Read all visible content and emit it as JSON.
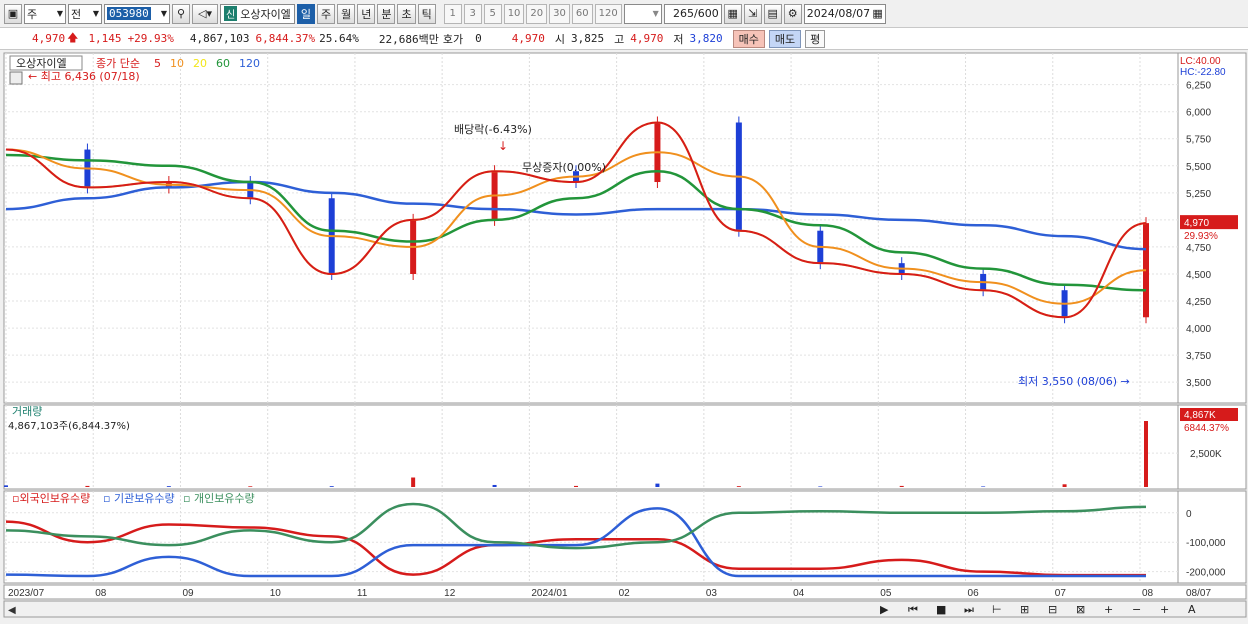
{
  "toolbar": {
    "market": "주",
    "prev": "전",
    "code": "053980",
    "stock_tag": "신",
    "stock_name": "오상자이엘",
    "periods": [
      "일",
      "주",
      "월",
      "년",
      "분",
      "초",
      "틱"
    ],
    "active_period": "일",
    "minute_units": [
      "1",
      "3",
      "5",
      "10",
      "20",
      "30",
      "60",
      "120"
    ],
    "count_value": "265",
    "count_total": "/600",
    "date": "2024/08/07"
  },
  "quote": {
    "price": "4,970",
    "change": "1,145",
    "change_pct": "+29.93%",
    "volume": "4,867,103",
    "volume_pct": "6,844.37%",
    "turnover": "25.64%",
    "amount": "22,686백만",
    "hoga_label": "호가",
    "hoga_value": "0",
    "hoga_price": "4,970",
    "open_label": "시",
    "open": "3,825",
    "high_label": "고",
    "high": "4,970",
    "low_label": "저",
    "low": "3,820",
    "buy_label": "매수",
    "sell_label": "매도",
    "avg_label": "평"
  },
  "chart": {
    "legend_name": "오상자이엘",
    "ma_label": "종가 단순",
    "ma_periods": [
      "5",
      "10",
      "20",
      "60",
      "120"
    ],
    "max_label": "최고 6,436 (07/18)",
    "min_label": "최저 3,550 (08/06)",
    "lc_label": "LC:40.00",
    "hc_label": "HC:-22.80",
    "dividend_label": "배당락(-6.43%)",
    "bonus_label": "무상증자(0.00%)",
    "last_price_label": "4,970",
    "last_pct_label": "29.93%",
    "volume_title": "거래량",
    "volume_value_label": "4,867,103주(6,844.37%)",
    "volume_last_label": "4,867K",
    "volume_last_pct": "6844.37%",
    "holdings_legend": [
      "외국인보유수량",
      "기관보유수량",
      "개인보유수량"
    ],
    "price_ticks": [
      "6,250",
      "6,000",
      "5,750",
      "5,500",
      "5,250",
      "5,000",
      "4,750",
      "4,500",
      "4,250",
      "4,000",
      "3,750",
      "3,500"
    ],
    "volume_tick": "2,500K",
    "holdings_ticks": [
      "0",
      "-100,000",
      "-200,000"
    ],
    "x_ticks": [
      "2023/07",
      "08",
      "09",
      "10",
      "11",
      "12",
      "2024/01",
      "02",
      "03",
      "04",
      "05",
      "06",
      "07",
      "08"
    ],
    "x_right_label": "08/07"
  },
  "colors": {
    "ma5": "#d61b1b",
    "ma10": "#f0901e",
    "ma20": "#f2e61a",
    "ma60": "#22953a",
    "ma120": "#2e5fd6",
    "up": "#d61b1b",
    "down": "#1d3fd6",
    "foreign": "#d61b1b",
    "institution": "#2e5fd6",
    "individual": "#3b8f5e"
  },
  "chart_data": [
    {
      "type": "line",
      "title": "오상자이엘",
      "x": [
        "2023/07",
        "08",
        "09",
        "10",
        "11",
        "12",
        "2024/01",
        "02",
        "03",
        "04",
        "05",
        "06",
        "07",
        "08",
        "08/07"
      ],
      "series": [
        {
          "name": "종가",
          "values": [
            5650,
            5300,
            5350,
            5200,
            4500,
            5000,
            5450,
            5350,
            5900,
            4900,
            4600,
            4500,
            4350,
            4100,
            4970
          ]
        },
        {
          "name": "60",
          "values": [
            5600,
            5550,
            5500,
            5350,
            4900,
            4800,
            5000,
            5200,
            5450,
            5100,
            4950,
            4700,
            4550,
            4400,
            4350
          ]
        },
        {
          "name": "120",
          "values": [
            5100,
            5200,
            5300,
            5350,
            5250,
            5150,
            5100,
            5050,
            5100,
            5100,
            5050,
            5000,
            4950,
            4850,
            4730
          ]
        }
      ],
      "ylim": [
        3400,
        6450
      ]
    },
    {
      "type": "bar",
      "title": "거래량",
      "x": [
        "2023/07",
        "08",
        "09",
        "10",
        "11",
        "12",
        "2024/01",
        "02",
        "03",
        "04",
        "05",
        "06",
        "07",
        "08",
        "08/07"
      ],
      "series": [
        {
          "name": "거래량",
          "values": [
            120000,
            80000,
            60000,
            50000,
            60000,
            700000,
            150000,
            80000,
            250000,
            60000,
            40000,
            80000,
            40000,
            200000,
            4867103
          ]
        }
      ]
    },
    {
      "type": "line",
      "title": "보유수량",
      "x": [
        "2023/07",
        "08",
        "09",
        "10",
        "11",
        "12",
        "2024/01",
        "02",
        "03",
        "04",
        "05",
        "06",
        "07",
        "08",
        "08/07"
      ],
      "series": [
        {
          "name": "외국인보유수량",
          "values": [
            -30000,
            -100000,
            -40000,
            -50000,
            -80000,
            -210000,
            -110000,
            -90000,
            -90000,
            -190000,
            -190000,
            -160000,
            -200000,
            -212000,
            -212000
          ]
        },
        {
          "name": "기관보유수량",
          "values": [
            -210000,
            -215000,
            -150000,
            -215000,
            -215000,
            -110000,
            -110000,
            -110000,
            15000,
            -215000,
            -215000,
            -215000,
            -215000,
            -215000,
            -215000
          ]
        },
        {
          "name": "개인보유수량",
          "values": [
            -60000,
            -80000,
            -110000,
            -60000,
            -100000,
            30000,
            -100000,
            -120000,
            -100000,
            0,
            5000,
            0,
            0,
            5000,
            20000
          ]
        }
      ]
    }
  ]
}
